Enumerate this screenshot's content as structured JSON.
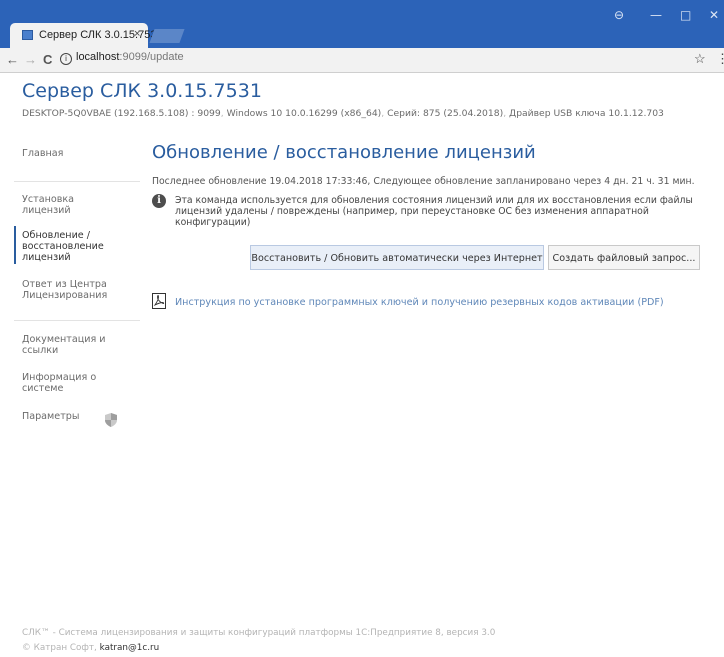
{
  "browser": {
    "tab_title": "Сервер СЛК 3.0.15.7531",
    "tab_close": "×",
    "window_controls": {
      "account": "⊖",
      "minimize": "—",
      "maximize": "□",
      "close": "✕"
    },
    "nav": {
      "back": "←",
      "forward": "→",
      "reload": "C"
    },
    "url_host": "localhost",
    "url_path": ":9099/update",
    "star": "☆",
    "menu": "⋮"
  },
  "app": {
    "title": "Сервер СЛК 3.0.15.7531",
    "sysinfo": {
      "host": "DESKTOP-5Q0VBAE (192.168.5.108) : 9099",
      "os": "Windows 10 10.0.16299 (x86_64)",
      "serial": "Серий: 875 (25.04.2018)",
      "driver": "Драйвер USB ключа 10.1.12.703"
    }
  },
  "sidebar": {
    "items": [
      {
        "label": "Главная"
      },
      {
        "label": "Установка\nлицензий"
      },
      {
        "label": "Обновление /\nвосстановление\nлицензий"
      },
      {
        "label": "Ответ из Центра\nЛицензирования"
      },
      {
        "label": "Документация и\nссылки"
      },
      {
        "label": "Информация о\nсистеме"
      },
      {
        "label": "Параметры"
      }
    ]
  },
  "main": {
    "title": "Обновление / восстановление лицензий",
    "last_update": "Последнее обновление 19.04.2018 17:33:46, Следующее обновление запланировано через 4 дн. 21 ч. 31 мин.",
    "note_icon": "i",
    "note": "Эта команда используется для обновления состояния лицензий или для их восстановления если файлы\nлицензий удалены / повреждены (например, при переустановке ОС без изменения аппаратной\nконфигурации)",
    "buttons": {
      "auto": "Восстановить / Обновить автоматически через Интернет",
      "file": "Создать файловый запрос..."
    },
    "pdf_link": "Инструкция по установке программных ключей и получению резервных кодов активации (PDF)"
  },
  "footer": {
    "line1": "СЛК™ - Система лицензирования и защиты конфигураций платформы 1С:Предприятие 8, версия 3.0",
    "copyright": "© Катран Софт,",
    "email": "katran@1c.ru"
  },
  "colors": {
    "accent": "#2a5d9f",
    "titlebar": "#2c63b8"
  }
}
